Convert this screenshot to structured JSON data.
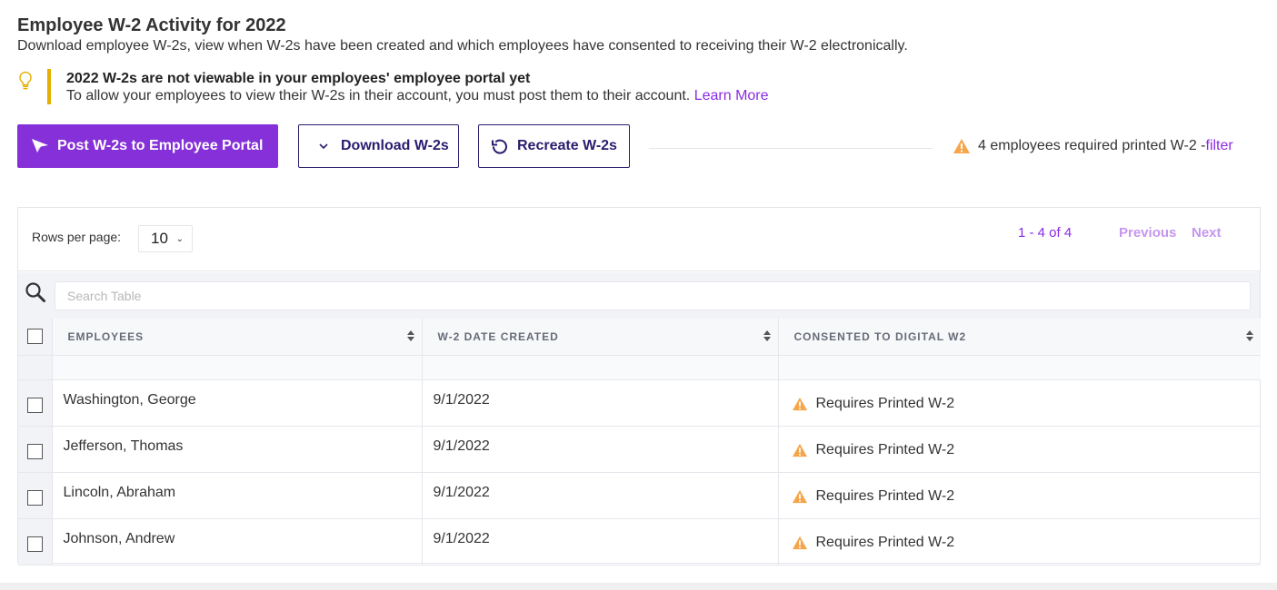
{
  "header": {
    "title": "Employee W-2 Activity for 2022",
    "subtitle": "Download employee W-2s, view when W-2s have been created and which employees have consented to receiving their W-2 electronically."
  },
  "notice": {
    "icon": "lightbulb-icon",
    "title": "2022 W-2s are not viewable in your employees' employee portal yet",
    "body": "To allow your employees to view their W-2s in their account, you must post them to their account.",
    "link": "Learn More",
    "accent_color": "#e5b000"
  },
  "actions": {
    "post": {
      "label": "Post W-2s to Employee Portal",
      "icon": "paper-plane-icon"
    },
    "download": {
      "label": "Download W-2s",
      "icon": "chevron-down-icon"
    },
    "recreate": {
      "label": "Recreate W-2s",
      "icon": "refresh-icon"
    }
  },
  "summary": {
    "icon": "warning-icon",
    "text": "4 employees required printed W-2 - ",
    "link": "filter",
    "warning_color": "#f5a54a"
  },
  "table": {
    "rows_per_page_label": "Rows per page:",
    "rows_per_page_value": "10",
    "pager_count": "1 - 4 of 4",
    "previous_label": "Previous",
    "next_label": "Next",
    "search_placeholder": "Search Table",
    "columns": [
      "EMPLOYEES",
      "W-2 DATE CREATED",
      "CONSENTED TO DIGITAL W2"
    ],
    "rows": [
      {
        "employee": "Washington, George",
        "date_created": "9/1/2022",
        "consent": "Requires Printed W-2"
      },
      {
        "employee": "Jefferson, Thomas",
        "date_created": "9/1/2022",
        "consent": "Requires Printed W-2"
      },
      {
        "employee": "Lincoln, Abraham",
        "date_created": "9/1/2022",
        "consent": "Requires Printed W-2"
      },
      {
        "employee": "Johnson, Andrew",
        "date_created": "9/1/2022",
        "consent": "Requires Printed W-2"
      }
    ]
  },
  "colors": {
    "primary": "#8530d8",
    "outline_button": "#2a1d6e",
    "link": "#8a2be2",
    "pager_disabled": "#c596ee"
  }
}
